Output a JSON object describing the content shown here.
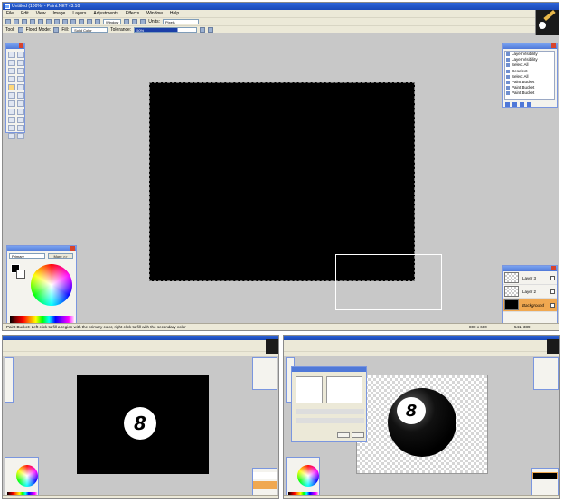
{
  "main": {
    "title": "Untitled (100%) - Paint.NET v3.10",
    "menu": [
      "File",
      "Edit",
      "View",
      "Image",
      "Layers",
      "Adjustments",
      "Effects",
      "Window",
      "Help"
    ],
    "toolbar": {
      "window_label": "Window",
      "units_label": "Units:",
      "units_value": "Pixels"
    },
    "options_bar": {
      "tool_label": "Tool:",
      "flood_mode_label": "Flood Mode:",
      "fill_label": "Fill:",
      "fill_value": "Solid Color",
      "tolerance_label": "Tolerance:",
      "tolerance_value": "50%"
    },
    "history": {
      "items": [
        "Layer Visibility",
        "Layer Visibility",
        "Select All",
        "Deselect",
        "Select All",
        "Paint Bucket",
        "Paint Bucket",
        "Paint Bucket"
      ]
    },
    "layers": {
      "items": [
        {
          "name": "Layer 3",
          "checked": true
        },
        {
          "name": "Layer 2",
          "checked": false
        },
        {
          "name": "Background",
          "checked": true
        }
      ]
    },
    "colors": {
      "mode_value": "Primary",
      "more_label": "More >>"
    },
    "status": {
      "text": "Paint Bucket: Left click to fill a region with the primary color, right click to fill with the secondary color",
      "size": "800 x 600",
      "coords": "541, 389"
    }
  },
  "thumb2": {
    "ball_number": "8"
  },
  "thumb3": {
    "ball_number": "8"
  },
  "colors_accent": {
    "titlebar": "#1b49b8",
    "selected_layer": "#f0a850",
    "canvas": "#000000",
    "workspace": "#c8c8c8"
  }
}
